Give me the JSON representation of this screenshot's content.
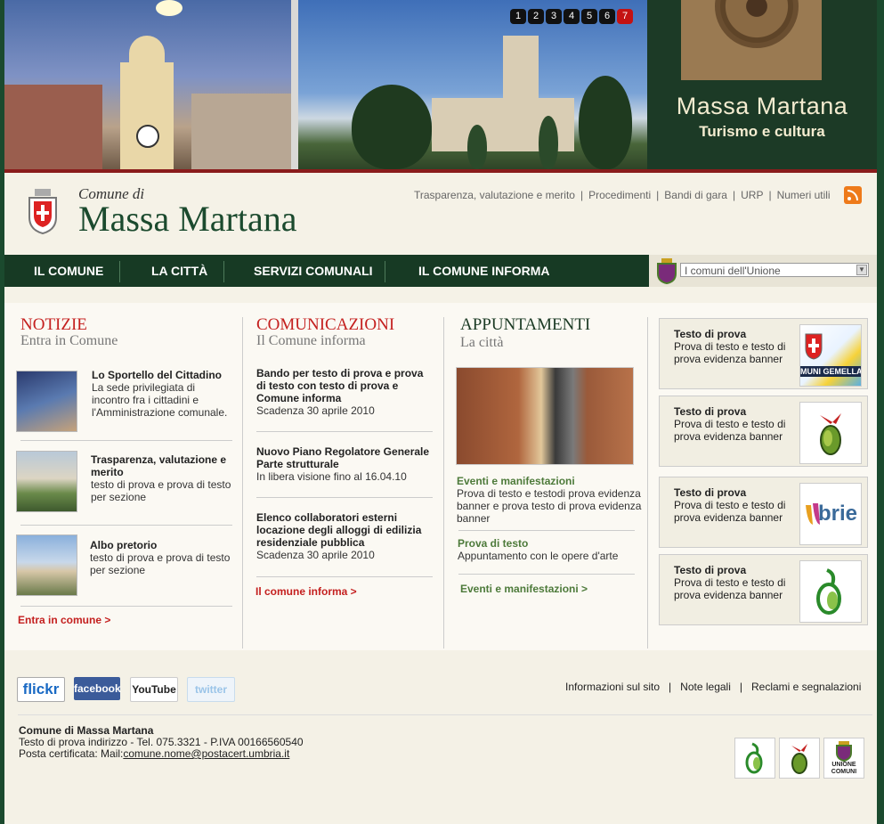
{
  "banner": {
    "slides": [
      "1",
      "2",
      "3",
      "4",
      "5",
      "6",
      "7"
    ],
    "active_slide": "7",
    "title": "Massa Martana",
    "subtitle": "Turismo e cultura"
  },
  "header": {
    "comune_di": "Comune di",
    "title": "Massa Martana",
    "links": [
      "Trasparenza, valutazione e merito",
      "Procedimenti",
      "Bandi di gara",
      "URP",
      "Numeri utili"
    ]
  },
  "nav": {
    "items": [
      "IL COMUNE",
      "LA CITTÀ",
      "SERVIZI COMUNALI",
      "IL COMUNE INFORMA"
    ],
    "select_value": "I comuni dell'Unione"
  },
  "notizie": {
    "title": "NOTIZIE",
    "subtitle": "Entra in Comune",
    "items": [
      {
        "title": "Lo Sportello del Cittadino",
        "text": "La  sede privilegiata di incontro fra i cittadini e l'Amministrazione comunale."
      },
      {
        "title": "Trasparenza, valutazione e merito",
        "text": "testo di prova e prova di testo per sezione"
      },
      {
        "title": "Albo pretorio",
        "text": "testo di prova e prova di testo per sezione"
      }
    ],
    "link": "Entra in comune >"
  },
  "comunicazioni": {
    "title": "COMUNICAZIONI",
    "subtitle": "Il Comune informa",
    "items": [
      {
        "title": "Bando per testo di prova e prova di testo con testo di prova e Comune informa",
        "text": "Scadenza 30 aprile 2010"
      },
      {
        "title": "Nuovo Piano Regolatore Generale Parte strutturale",
        "text": "In libera visione fino al 16.04.10"
      },
      {
        "title": "Elenco collaboratori esterni locazione degli alloggi di edilizia residenziale pubblica",
        "text": "Scadenza 30 aprile 2010"
      }
    ],
    "link": "Il comune informa >"
  },
  "appuntamenti": {
    "title": "APPUNTAMENTI",
    "subtitle": "La città",
    "items": [
      {
        "title": "Eventi e manifestazioni",
        "text": "Prova di testo e testodi prova evidenza banner  e prova  testo di prova evidenza banner"
      },
      {
        "title": "Prova di testo",
        "text": "Appuntamento con le opere d'arte"
      }
    ],
    "link": "Eventi e manifestazioni >"
  },
  "banners": [
    {
      "title": "Testo di prova",
      "text": "Prova di testo e testo di prova evidenza banner",
      "logo": "comuni-gemellati",
      "logo_text": "MUNI GEMELLAT"
    },
    {
      "title": "Testo di prova",
      "text": "Prova di testo e testo di prova evidenza banner",
      "logo": "olive-logo"
    },
    {
      "title": "Testo di prova",
      "text": "Prova di testo e testo di prova evidenza banner",
      "logo": "umbrie-logo",
      "logo_text": "brie"
    },
    {
      "title": "Testo di prova",
      "text": "Prova di testo e testo di prova evidenza banner",
      "logo": "olive-leaf-logo"
    }
  ],
  "social": [
    "flickr",
    "facebook",
    "YouTube",
    "twitter"
  ],
  "footer": {
    "links": [
      "Informazioni sul sito",
      "Note legali",
      "Reclami e segnalazioni"
    ],
    "org": "Comune di Massa Martana",
    "address": "Testo di prova indirizzo  - Tel. 075.3321 - P.IVA 00166560540",
    "pec_label": "Posta certificata: Mail:",
    "pec_email": "comune.nome@postacert.umbria.it",
    "union_logo_text": "UNIONE COMUNI"
  },
  "colors": {
    "dark_green": "#173a24",
    "red": "#c4201f",
    "accent_green": "#4d7a3a"
  }
}
